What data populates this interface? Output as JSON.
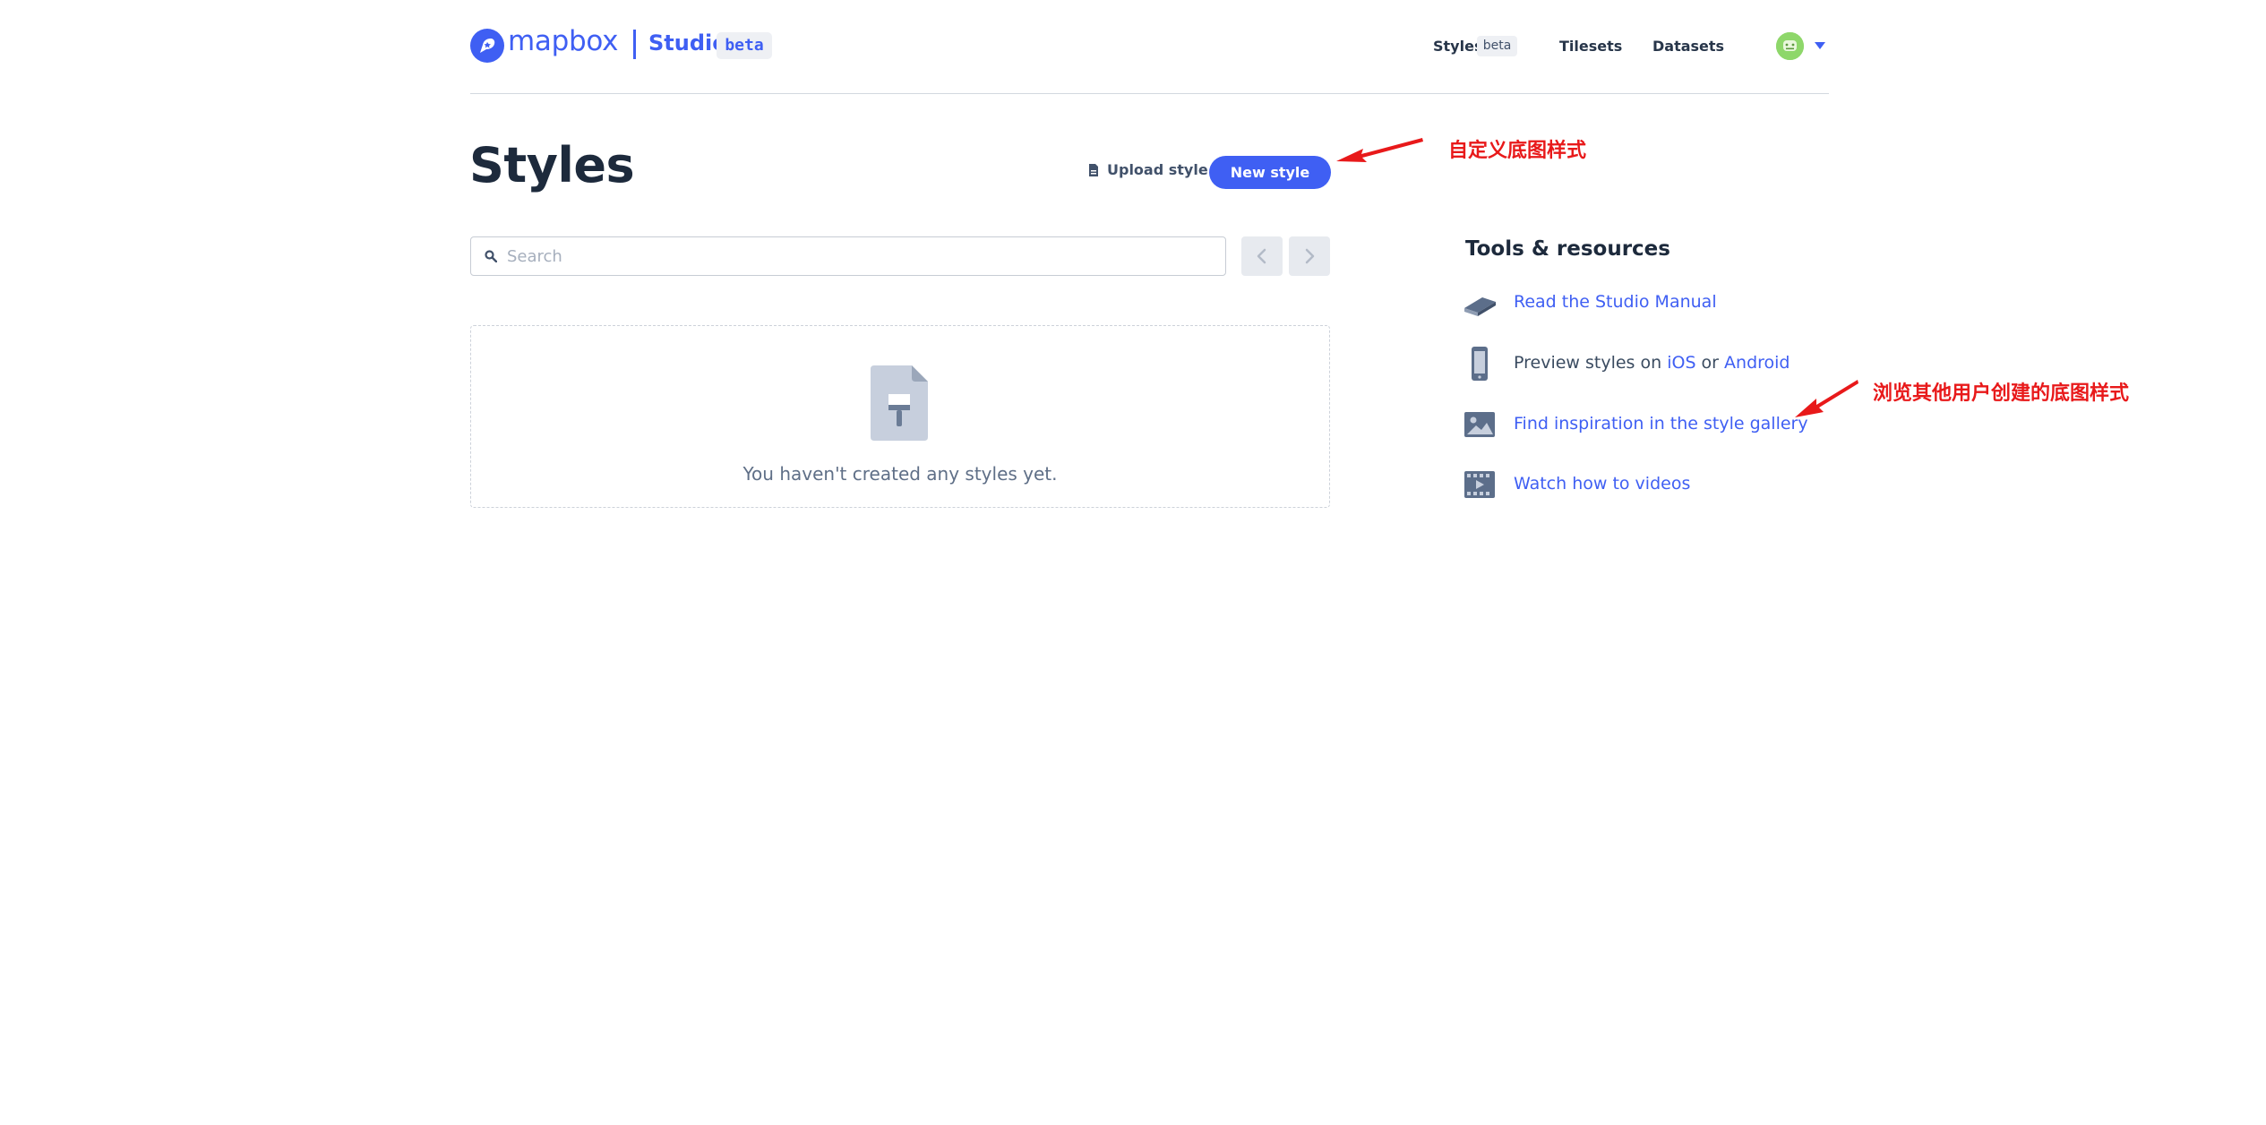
{
  "header": {
    "logo_text": "mapbox",
    "product": "Studio",
    "product_badge": "beta",
    "nav": {
      "styles": "Styles",
      "styles_badge": "beta",
      "tilesets": "Tilesets",
      "datasets": "Datasets"
    }
  },
  "main": {
    "title": "Styles",
    "upload_label": "Upload style",
    "new_style_label": "New style",
    "search": {
      "placeholder": "Search",
      "value": ""
    },
    "empty_message": "You haven't created any styles yet."
  },
  "tools": {
    "title": "Tools & resources",
    "manual_link": "Read the Studio Manual",
    "preview_prefix": "Preview styles on ",
    "preview_ios": "iOS",
    "preview_or": " or ",
    "preview_android": "Android",
    "gallery_link": "Find inspiration in the style gallery",
    "videos_link": "Watch how to videos"
  },
  "annotations": {
    "new_style_note": "自定义底图样式",
    "gallery_note": "浏览其他用户创建的底图样式"
  },
  "colors": {
    "brand": "#3f5ff3",
    "annotation": "#e8191a"
  },
  "icons": [
    "mapbox-logo-icon",
    "avatar-icon",
    "caret-down-icon",
    "upload-icon",
    "search-icon",
    "chevron-left-icon",
    "chevron-right-icon",
    "style-document-icon",
    "book-icon",
    "phone-icon",
    "image-icon",
    "film-icon"
  ]
}
